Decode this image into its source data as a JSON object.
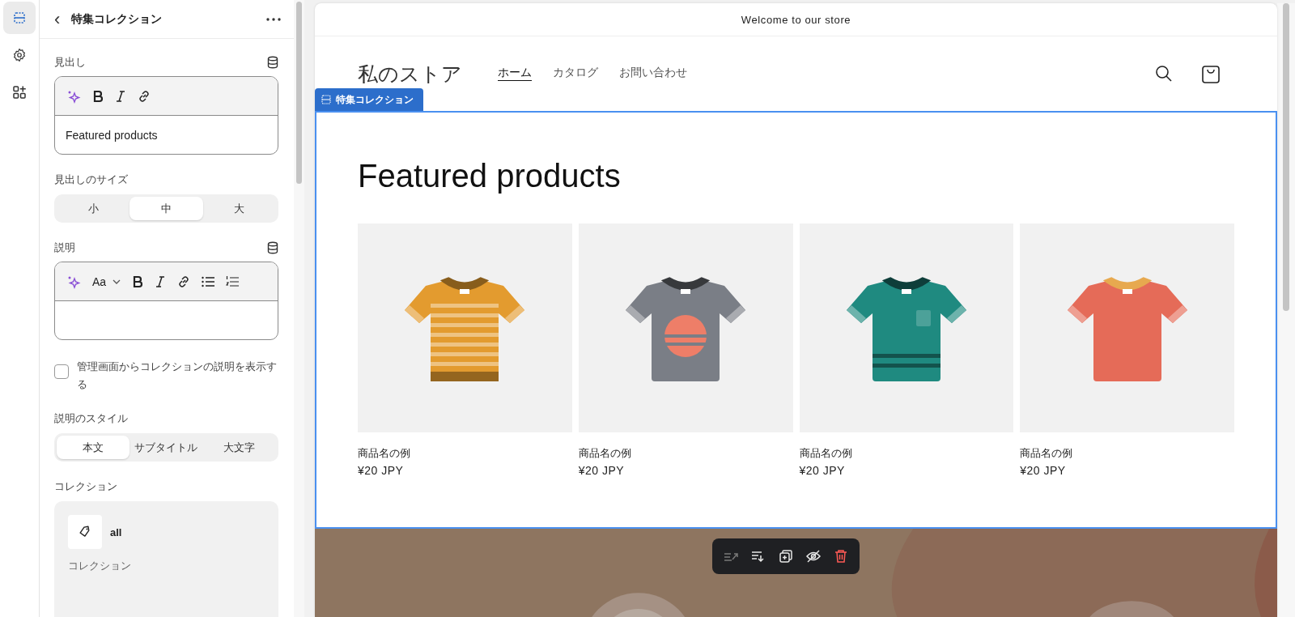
{
  "rail": [
    {
      "kind": "sections",
      "selected": true
    },
    {
      "kind": "settings",
      "selected": false
    },
    {
      "kind": "apps",
      "selected": false
    }
  ],
  "panel": {
    "title": "特集コレクション",
    "back": "‹",
    "heading_field": {
      "label": "見出し",
      "value": "Featured products"
    },
    "heading_size": {
      "label": "見出しのサイズ",
      "options": [
        {
          "label": "小",
          "selected": false
        },
        {
          "label": "中",
          "selected": true
        },
        {
          "label": "大",
          "selected": false
        }
      ]
    },
    "description_field": {
      "label": "説明",
      "format": "Aa"
    },
    "show_description": {
      "label": "管理画面からコレクションの説明を表示する",
      "checked": false
    },
    "description_style": {
      "label": "説明のスタイル",
      "options": [
        {
          "label": "本文",
          "selected": true
        },
        {
          "label": "サブタイトル",
          "selected": false
        },
        {
          "label": "大文字",
          "selected": false
        }
      ]
    },
    "collection": {
      "label": "コレクション",
      "name": "all",
      "caption": "コレクション"
    }
  },
  "preview": {
    "announcement": "Welcome to our store",
    "store_name": "私のストア",
    "nav": [
      {
        "label": "ホーム",
        "selected": true
      },
      {
        "label": "カタログ",
        "selected": false
      },
      {
        "label": "お問い合わせ",
        "selected": false
      }
    ],
    "section_tag": "特集コレクション",
    "heading": "Featured products",
    "products": [
      {
        "name": "商品名の例",
        "price": "¥20 JPY",
        "kind": "striped",
        "color": "#e39b2f"
      },
      {
        "name": "商品名の例",
        "price": "¥20 JPY",
        "kind": "graphic",
        "color": "#7a7e86"
      },
      {
        "name": "商品名の例",
        "price": "¥20 JPY",
        "kind": "pocket",
        "color": "#1f8a80"
      },
      {
        "name": "商品名の例",
        "price": "¥20 JPY",
        "kind": "plain",
        "color": "#e56b58"
      }
    ],
    "toolbar": [
      {
        "kind": "move-up",
        "disabled": true
      },
      {
        "kind": "move-down",
        "disabled": false
      },
      {
        "kind": "duplicate",
        "disabled": false
      },
      {
        "kind": "hide",
        "disabled": false
      },
      {
        "kind": "delete",
        "disabled": false
      }
    ]
  }
}
